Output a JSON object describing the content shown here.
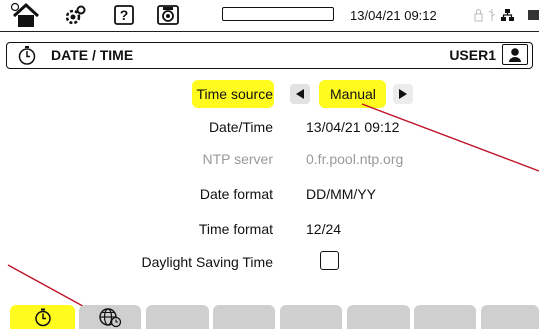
{
  "status_bar": {
    "datetime": "13/04/21 09:12",
    "progress_fraction": 0.0,
    "icons": [
      "home-icon",
      "gear-icon",
      "help-icon",
      "camera-icon",
      "lock-icon",
      "usb-icon",
      "network-icon",
      "battery-icon"
    ]
  },
  "title_bar": {
    "title": "DATE / TIME",
    "user": "USER1",
    "icons": [
      "stopwatch-icon",
      "user-icon"
    ]
  },
  "form": {
    "time_source": {
      "label": "Time source",
      "value": "Manual"
    },
    "datetime": {
      "label": "Date/Time",
      "value": "13/04/21 09:12"
    },
    "ntp_server": {
      "label": "NTP server",
      "value": "0.fr.pool.ntp.org"
    },
    "date_format": {
      "label": "Date format",
      "value": "DD/MM/YY"
    },
    "time_format": {
      "label": "Time format",
      "value": "12/24"
    },
    "dst": {
      "label": "Daylight Saving Time",
      "checked": false
    }
  },
  "tabs": {
    "icons": [
      "stopwatch-icon",
      "globe-clock-icon"
    ],
    "active_index": 0,
    "count": 8
  },
  "colors": {
    "highlight": "#fffb1f",
    "annotation": "#c0152a",
    "tab": "#cfcfcf",
    "dim_text": "#9a9a9a"
  }
}
